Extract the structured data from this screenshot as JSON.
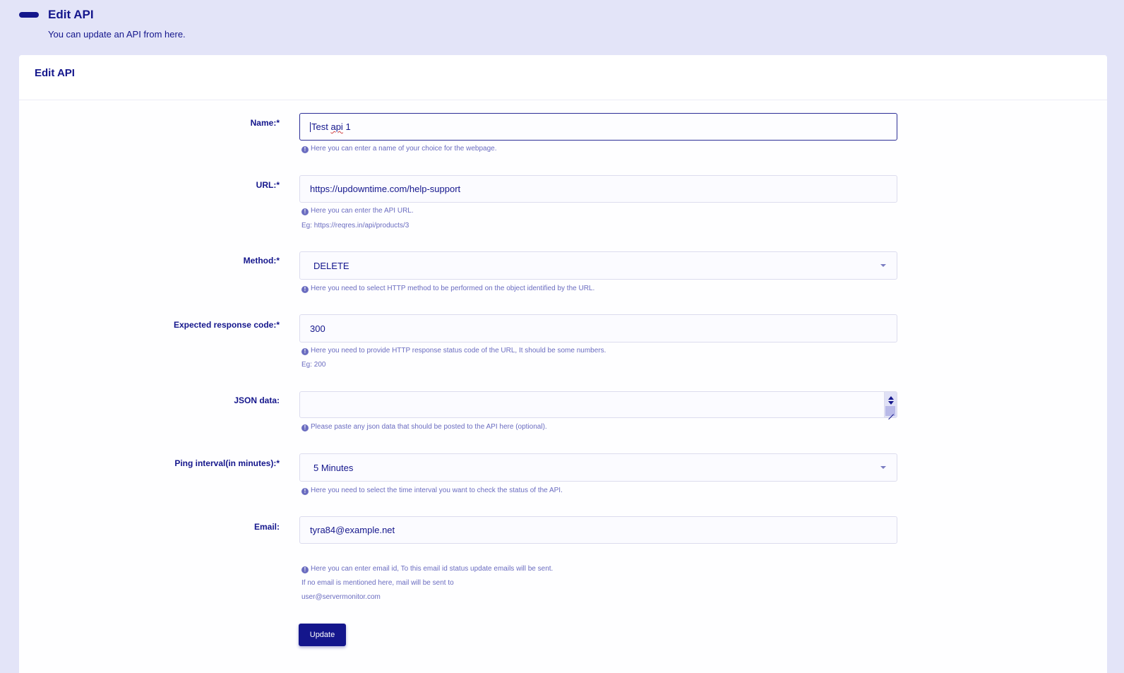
{
  "page_header": {
    "title": "Edit API",
    "subtitle": "You can update an API from here."
  },
  "card": {
    "title": "Edit API"
  },
  "form": {
    "name": {
      "label": "Name:*",
      "value_first": "Test",
      "value_squiggle": "api",
      "value_rest": "1",
      "help": "Here you can enter a name of your choice for the webpage."
    },
    "url": {
      "label": "URL:*",
      "value": "https://updowntime.com/help-support",
      "help": "Here you can enter the API URL.",
      "example": "Eg: https://reqres.in/api/products/3"
    },
    "method": {
      "label": "Method:*",
      "value": "DELETE",
      "help": "Here you need to select HTTP method to be performed on the object identified by the URL."
    },
    "expected_code": {
      "label": "Expected response code:*",
      "value": "300",
      "help": "Here you need to provide HTTP response status code of the URL, It should be some numbers.",
      "example": "Eg: 200"
    },
    "json_data": {
      "label": "JSON data:",
      "value": "",
      "help": "Please paste any json data that should be posted to the API here (optional)."
    },
    "ping_interval": {
      "label": "Ping interval(in minutes):*",
      "value": "5 Minutes",
      "help": "Here you need to select the time interval you want to check the status of the API."
    },
    "email": {
      "label": "Email:",
      "value": "tyra84@example.net",
      "help": "Here you can enter email id, To this email id status update emails will be sent.",
      "help_line2": "If no email is mentioned here, mail will be sent to",
      "help_line3": "user@servermonitor.com"
    },
    "submit_label": "Update"
  },
  "colors": {
    "background": "#e3e4f8",
    "primary": "#14168c",
    "help_text": "#6a6cc0"
  },
  "icons": {
    "header_bar": "minus-bar-icon",
    "info": "info-circle-icon",
    "select_arrow": "chevron-down-icon"
  }
}
